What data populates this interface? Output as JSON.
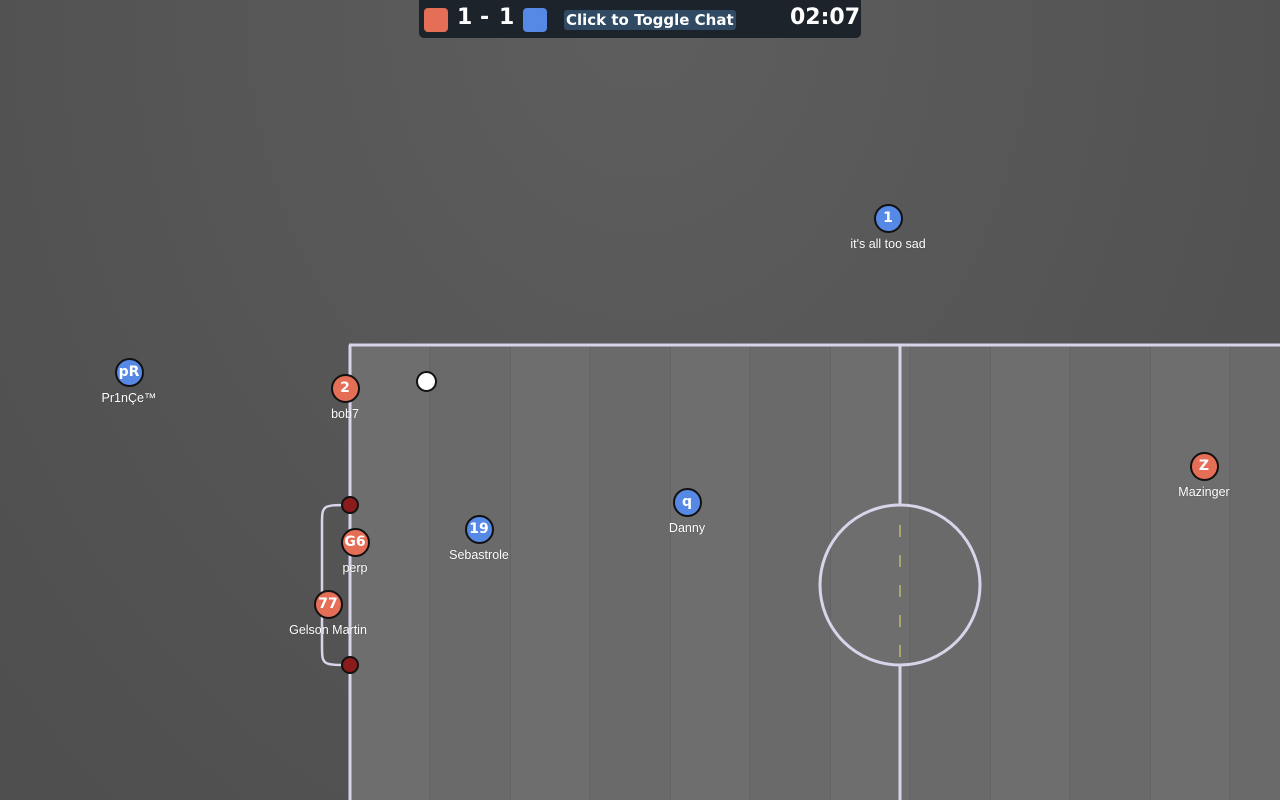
{
  "scoreboard": {
    "red_score": "1",
    "separator": "-",
    "blue_score": "1",
    "chat_toggle_label": "Click to Toggle Chat",
    "timer": "02:07",
    "red_color": "#e56e56",
    "blue_color": "#5689e5"
  },
  "players": [
    {
      "team": "blue",
      "avatar": "1",
      "name": "it's all too sad"
    },
    {
      "team": "blue",
      "avatar": "pR",
      "name": "Pr1nÇe™"
    },
    {
      "team": "red",
      "avatar": "2",
      "name": "bob7"
    },
    {
      "team": "red",
      "avatar": "Z",
      "name": "Mazinger"
    },
    {
      "team": "blue",
      "avatar": "q",
      "name": "Danny"
    },
    {
      "team": "blue",
      "avatar": "19",
      "name": "Sebastrole"
    },
    {
      "team": "red",
      "avatar": "G6",
      "name": "perp"
    },
    {
      "team": "red",
      "avatar": "77",
      "name": "Gelson Martin"
    }
  ],
  "field": {
    "line_color": "#d8d4ea",
    "pitch_color": "#6d6d6d",
    "goal_post_color": "#8b1a1a"
  }
}
